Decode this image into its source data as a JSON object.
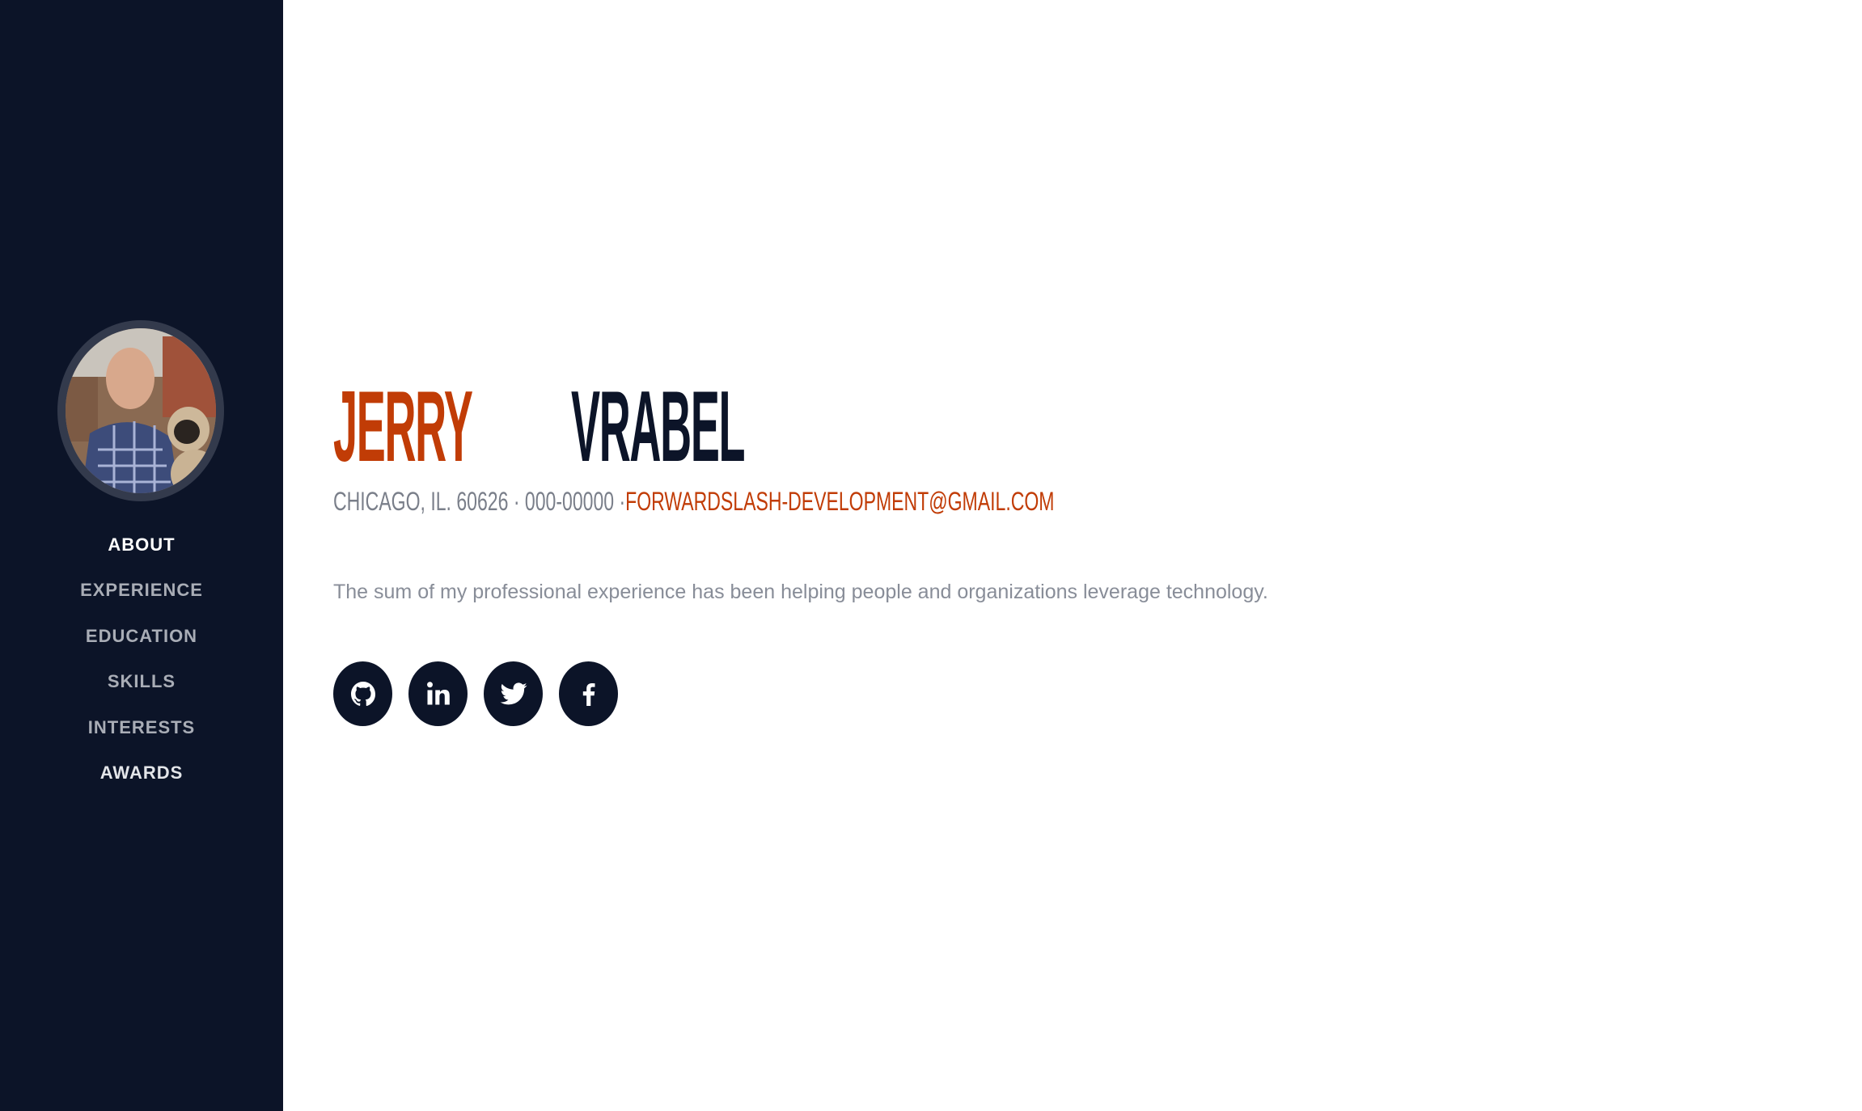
{
  "profile": {
    "first_name": "JERRY",
    "last_name": "VRABEL",
    "contact_prefix": "CHICAGO, IL. 60626 · 000-00000 ·",
    "email": "FORWARDSLASH-DEVELOPMENT@GMAIL.COM",
    "lead": "The sum of my professional experience has been helping people and organizations leverage technology."
  },
  "nav": {
    "items": [
      {
        "label": "ABOUT"
      },
      {
        "label": "EXPERIENCE"
      },
      {
        "label": "EDUCATION"
      },
      {
        "label": "SKILLS"
      },
      {
        "label": "INTERESTS"
      },
      {
        "label": "AWARDS"
      }
    ],
    "active": "ABOUT"
  },
  "social": {
    "icons": [
      "github-icon",
      "linkedin-icon",
      "twitter-icon",
      "facebook-icon"
    ]
  },
  "colors": {
    "sidebar_bg": "#0c1428",
    "accent": "#c13c06",
    "primary_text": "#0c1428",
    "muted_text": "#888d98"
  }
}
